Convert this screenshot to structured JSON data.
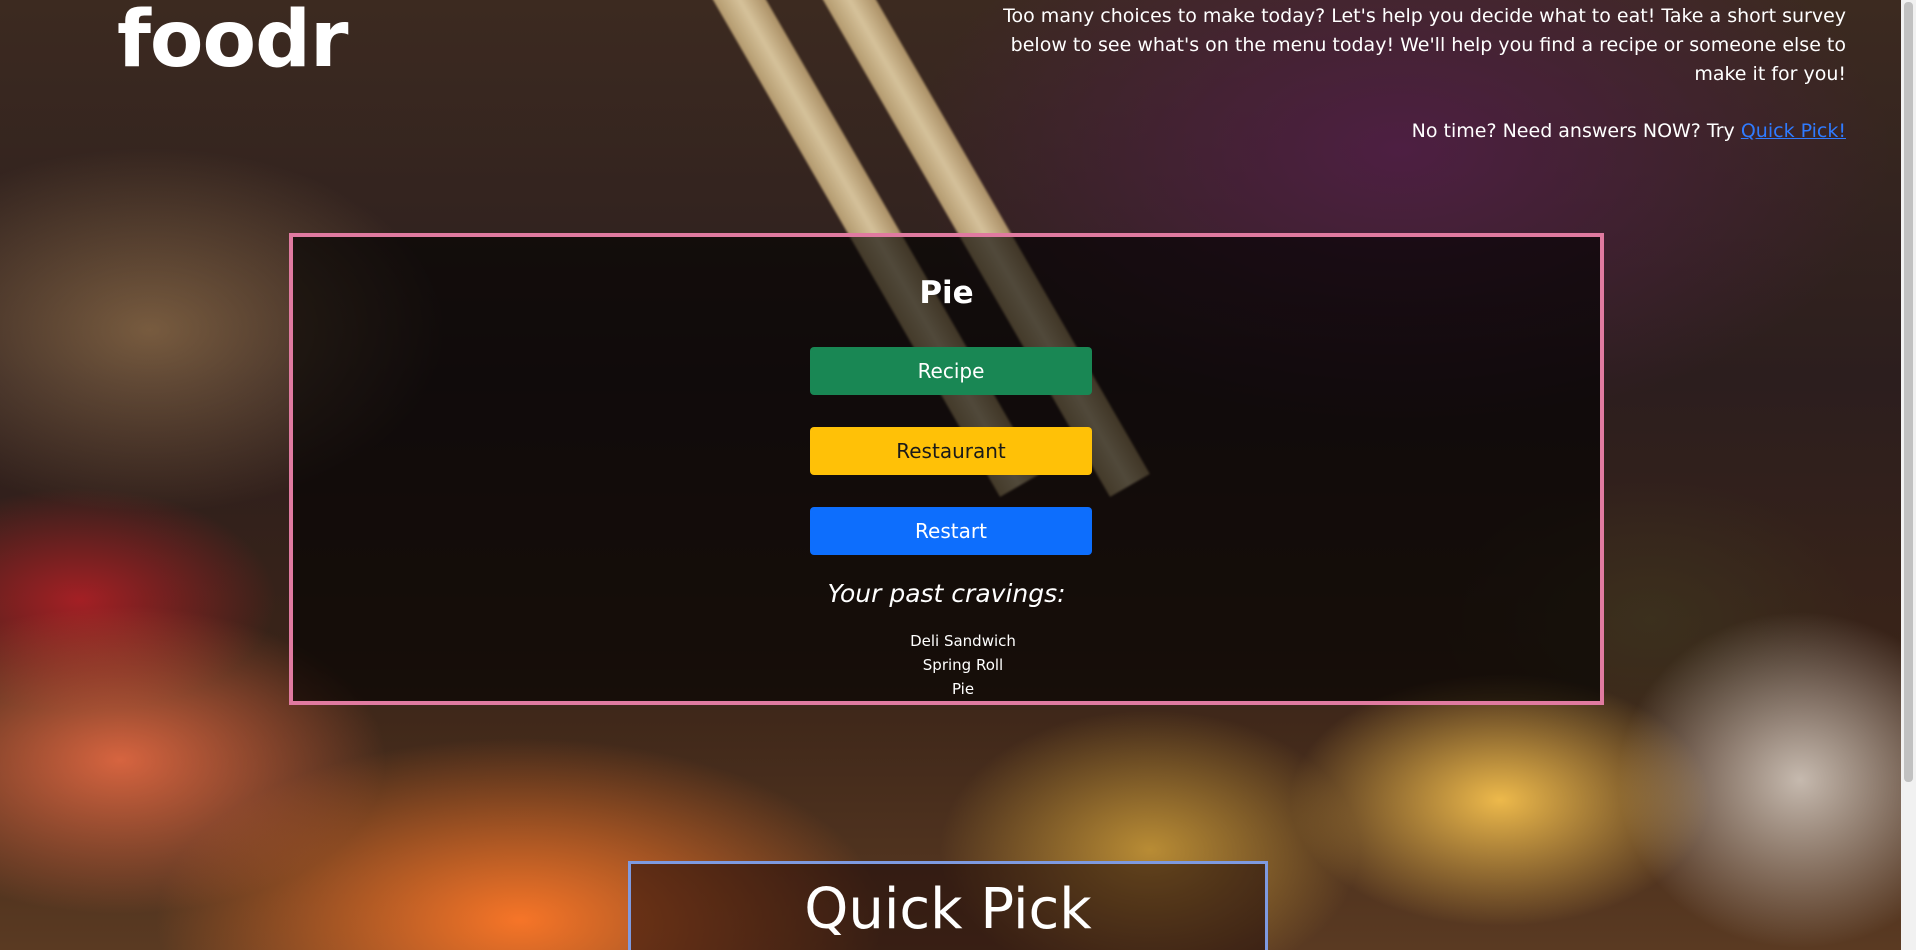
{
  "brand": {
    "logo": "foodr"
  },
  "intro": {
    "text": "Too many choices to make today? Let's help you decide what to eat! Take a short survey below to see what's on the menu today! We'll help you find a recipe or someone else to make it for you!",
    "quick_prefix": "No time? Need answers NOW? Try ",
    "quick_link": "Quick Pick!",
    "link_color": "#2f7bff"
  },
  "survey": {
    "title": "Pie",
    "buttons": {
      "recipe": "Recipe",
      "restaurant": "Restaurant",
      "restart": "Restart"
    },
    "past_cravings_label": "Your past cravings:",
    "past_cravings": [
      "Deli Sandwich",
      "Spring Roll",
      "Pie"
    ],
    "border_color": "#e07aa0"
  },
  "quick_pick": {
    "title": "Quick Pick",
    "border_color": "#7e9ae0"
  },
  "colors": {
    "recipe": "#198754",
    "restaurant": "#ffc107",
    "restart": "#0d6efd"
  }
}
